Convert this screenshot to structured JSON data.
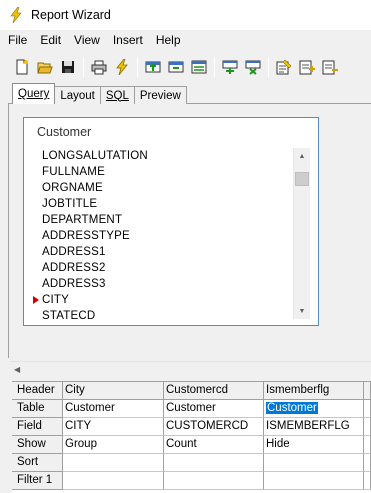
{
  "window": {
    "title": "Report Wizard",
    "icon": "lightning-icon"
  },
  "menu": [
    "File",
    "Edit",
    "View",
    "Insert",
    "Help"
  ],
  "toolbar": {
    "groups": [
      [
        "new-icon",
        "open-icon",
        "save-icon"
      ],
      [
        "print-icon",
        "run-icon"
      ],
      [
        "add-table-icon",
        "remove-table-icon",
        "table-properties-icon"
      ],
      [
        "add-join-icon",
        "remove-join-icon"
      ],
      [
        "edit-sql-icon",
        "add-field-icon",
        "remove-field-icon"
      ]
    ]
  },
  "tabs": [
    {
      "label": "Query",
      "active": true
    },
    {
      "label": "Layout",
      "active": false
    },
    {
      "label": "SQL",
      "active": false
    },
    {
      "label": "Preview",
      "active": false
    }
  ],
  "table_box": {
    "title": "Customer",
    "fields": [
      {
        "name": "LONGSALUTATION",
        "marked": false
      },
      {
        "name": "FULLNAME",
        "marked": false
      },
      {
        "name": "ORGNAME",
        "marked": false
      },
      {
        "name": "JOBTITLE",
        "marked": false
      },
      {
        "name": "DEPARTMENT",
        "marked": false
      },
      {
        "name": "ADDRESSTYPE",
        "marked": false
      },
      {
        "name": "ADDRESS1",
        "marked": false
      },
      {
        "name": "ADDRESS2",
        "marked": false
      },
      {
        "name": "ADDRESS3",
        "marked": false
      },
      {
        "name": "CITY",
        "marked": true
      },
      {
        "name": "STATECD",
        "marked": false
      }
    ]
  },
  "grid": {
    "row_headers": [
      "Header",
      "Table",
      "Field",
      "Show",
      "Sort",
      "Filter 1"
    ],
    "rows": [
      [
        "City",
        "Customercd",
        "Ismemberflg",
        ""
      ],
      [
        "Customer",
        "Customer",
        "Customer",
        ""
      ],
      [
        "CITY",
        "CUSTOMERCD",
        "ISMEMBERFLG",
        ""
      ],
      [
        "Group",
        "Count",
        "Hide",
        ""
      ],
      [
        "",
        "",
        "",
        ""
      ],
      [
        "",
        "",
        "",
        ""
      ]
    ],
    "selected_cell": {
      "row": 1,
      "col": 2
    }
  }
}
